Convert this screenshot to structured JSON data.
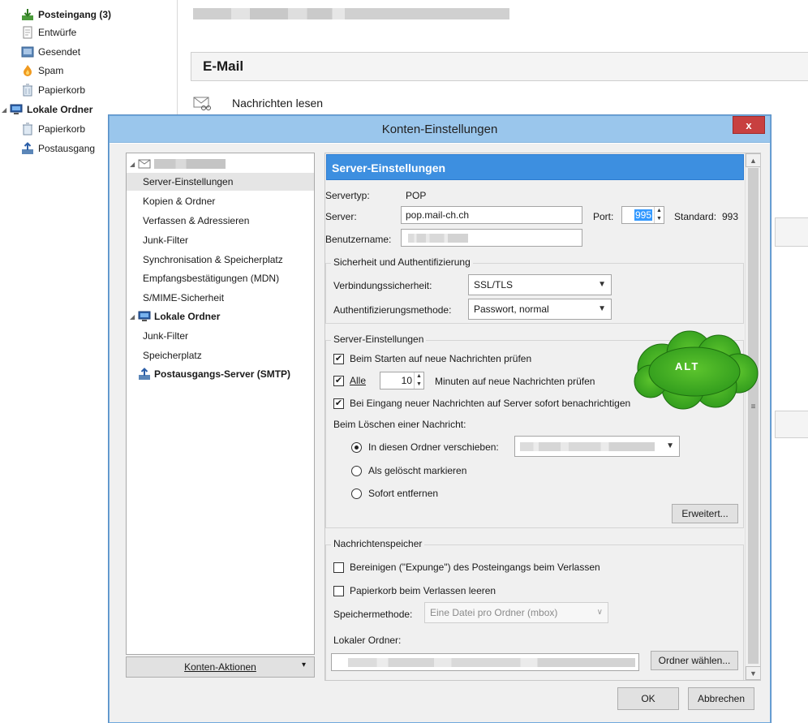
{
  "folders": {
    "inbox": "Posteingang (3)",
    "drafts": "Entwürfe",
    "sent": "Gesendet",
    "spam": "Spam",
    "trash": "Papierkorb",
    "local_folders": "Lokale Ordner",
    "local_trash": "Papierkorb",
    "outbox": "Postausgang"
  },
  "main": {
    "header": "E-Mail",
    "read_messages": "Nachrichten lesen"
  },
  "dialog": {
    "title": "Konten-Einstellungen",
    "close": "x",
    "tree": [
      {
        "label": "Server-Einstellungen"
      },
      {
        "label": "Kopien & Ordner"
      },
      {
        "label": "Verfassen & Adressieren"
      },
      {
        "label": "Junk-Filter"
      },
      {
        "label": "Synchronisation & Speicherplatz"
      },
      {
        "label": "Empfangsbestätigungen (MDN)"
      },
      {
        "label": "S/MIME-Sicherheit"
      },
      {
        "label": "Lokale Ordner"
      },
      {
        "label": "Junk-Filter"
      },
      {
        "label": "Speicherplatz"
      },
      {
        "label": "Postausgangs-Server (SMTP)"
      }
    ],
    "account_actions": "Konten-Aktionen",
    "ok": "OK",
    "cancel": "Abbrechen"
  },
  "server": {
    "header": "Server-Einstellungen",
    "type_label": "Servertyp:",
    "type_value": "POP",
    "server_label": "Server:",
    "server_value": "pop.mail-ch.ch",
    "port_label": "Port:",
    "port_value": "995",
    "default_label": "Standard:",
    "default_value": "993",
    "username_label": "Benutzername:",
    "security_group": "Sicherheit und Authentifizierung",
    "conn_security_label": "Verbindungssicherheit:",
    "conn_security_value": "SSL/TLS",
    "auth_label": "Authentifizierungsmethode:",
    "auth_value": "Passwort, normal",
    "settings_group": "Server-Einstellungen",
    "check_on_start": "Beim Starten auf neue Nachrichten prüfen",
    "check_every_label": "Alle",
    "check_every_value": "10",
    "check_every_suffix": "Minuten auf neue Nachrichten prüfen",
    "notify_on_arrival": "Bei Eingang neuer Nachrichten auf Server sofort benachrichtigen",
    "on_delete_label": "Beim Löschen einer Nachricht:",
    "move_to_folder": "In diesen Ordner verschieben:",
    "mark_deleted": "Als gelöscht markieren",
    "delete_now": "Sofort entfernen",
    "advanced": "Erweitert...",
    "storage_group": "Nachrichtenspeicher",
    "expunge": "Bereinigen (\"Expunge\") des Posteingangs beim Verlassen",
    "empty_trash": "Papierkorb beim Verlassen leeren",
    "store_method_label": "Speichermethode:",
    "store_method_value": "Eine Datei pro Ordner (mbox)",
    "local_folder_label": "Lokaler Ordner:",
    "choose_folder": "Ordner wählen..."
  },
  "annotation": {
    "cloud_text": "ALT"
  },
  "colors": {
    "titlebar": "#9ac6ec",
    "pane_header": "#3d8fe0",
    "close": "#c84040",
    "cloud": "#2f9a1c"
  }
}
